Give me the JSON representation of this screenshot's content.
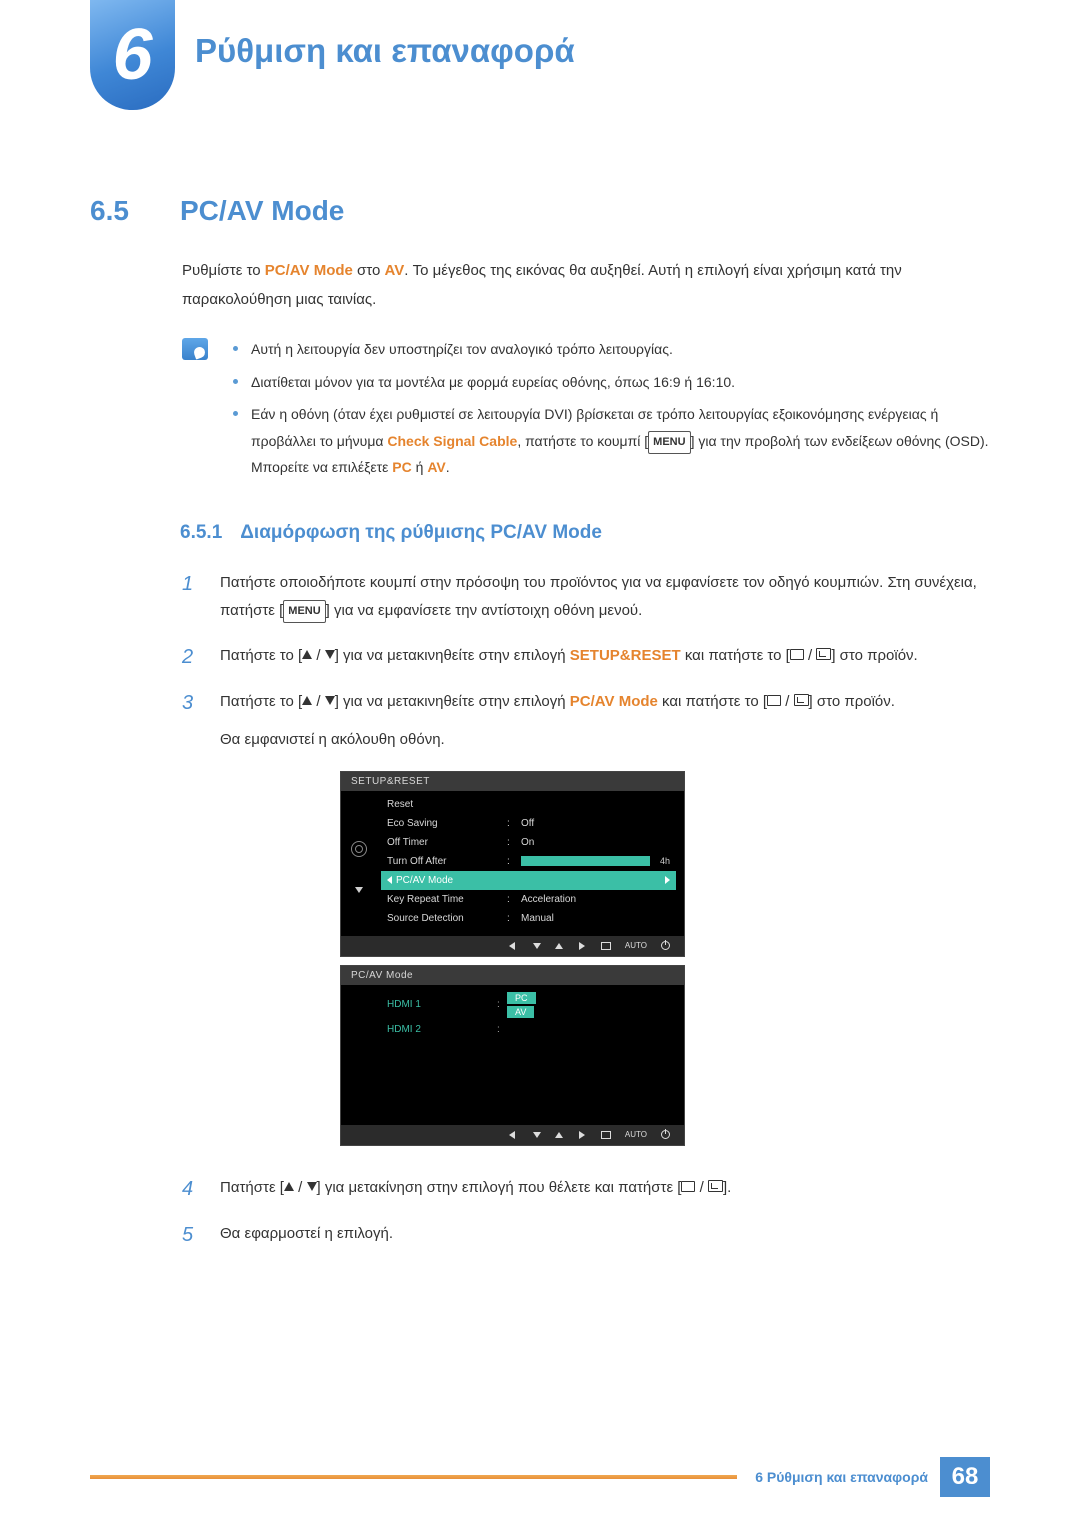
{
  "chapter": {
    "number": "6",
    "title": "Ρύθμιση και επαναφορά"
  },
  "section": {
    "number": "6.5",
    "title": "PC/AV Mode"
  },
  "intro": {
    "p1_before": "Ρυθμίστε το ",
    "p1_hl1": "PC/AV Mode",
    "p1_mid": " στο ",
    "p1_hl2": "AV",
    "p1_after": ". Το μέγεθος της εικόνας θα αυξηθεί. Αυτή η επιλογή είναι χρήσιμη κατά την παρακολούθηση μιας ταινίας."
  },
  "notes": {
    "n1": "Αυτή η λειτουργία δεν υποστηρίζει τον αναλογικό τρόπο λειτουργίας.",
    "n2": "Διατίθεται μόνον για τα μοντέλα με φορμά ευρείας οθόνης, όπως 16:9 ή 16:10.",
    "n3_a": "Εάν η οθόνη (όταν έχει ρυθμιστεί σε λειτουργία DVI) βρίσκεται σε τρόπο λειτουργίας εξοικονόμησης ενέργειας ή προβάλλει το μήνυμα ",
    "n3_hl1": "Check Signal Cable",
    "n3_b": ", πατήστε το κουμπί [",
    "n3_menu": "MENU",
    "n3_c": "] για την προβολή των ενδείξεων οθόνης (OSD). Μπορείτε να επιλέξετε ",
    "n3_hl2": "PC",
    "n3_d": " ή ",
    "n3_hl3": "AV",
    "n3_e": "."
  },
  "subsection": {
    "number": "6.5.1",
    "title": "Διαμόρφωση της ρύθμισης PC/AV Mode"
  },
  "steps": {
    "s1": {
      "a": "Πατήστε οποιοδήποτε κουμπί στην πρόσοψη του προϊόντος για να εμφανίσετε τον οδηγό κουμπιών. Στη συνέχεια, πατήστε [",
      "menu": "MENU",
      "b": "] για να εμφανίσετε την αντίστοιχη οθόνη μενού."
    },
    "s2": {
      "a": "Πατήστε το [",
      "b": "] για να μετακινηθείτε στην επιλογή ",
      "hl": "SETUP&RESET",
      "c": " και πατήστε το [",
      "d": "] στο προϊόν."
    },
    "s3": {
      "a": "Πατήστε το [",
      "b": "] για να μετακινηθείτε στην επιλογή ",
      "hl": "PC/AV Mode",
      "c": " και πατήστε το [",
      "d": "] στο προϊόν.",
      "e": "Θα εμφανιστεί η ακόλουθη οθόνη."
    },
    "s4": {
      "a": "Πατήστε [",
      "b": "] για μετακίνηση στην επιλογή που θέλετε και πατήστε [",
      "c": "]."
    },
    "s5": "Θα εφαρμοστεί η επιλογή."
  },
  "osd1": {
    "header": "SETUP&RESET",
    "rows": [
      {
        "label": "Reset",
        "value": ""
      },
      {
        "label": "Eco Saving",
        "value": "Off"
      },
      {
        "label": "Off Timer",
        "value": "On"
      },
      {
        "label": "Turn Off After",
        "value": "4h",
        "bar": true
      },
      {
        "label": "PC/AV Mode",
        "value": "",
        "selected": true
      },
      {
        "label": "Key Repeat Time",
        "value": "Acceleration"
      },
      {
        "label": "Source Detection",
        "value": "Manual"
      }
    ],
    "auto": "AUTO"
  },
  "osd2": {
    "header": "PC/AV Mode",
    "rows": [
      {
        "label": "HDMI 1",
        "pc": "PC",
        "av": "AV"
      },
      {
        "label": "HDMI 2"
      }
    ],
    "auto": "AUTO"
  },
  "footer": {
    "label": "6 Ρύθμιση και επαναφορά",
    "page": "68"
  }
}
